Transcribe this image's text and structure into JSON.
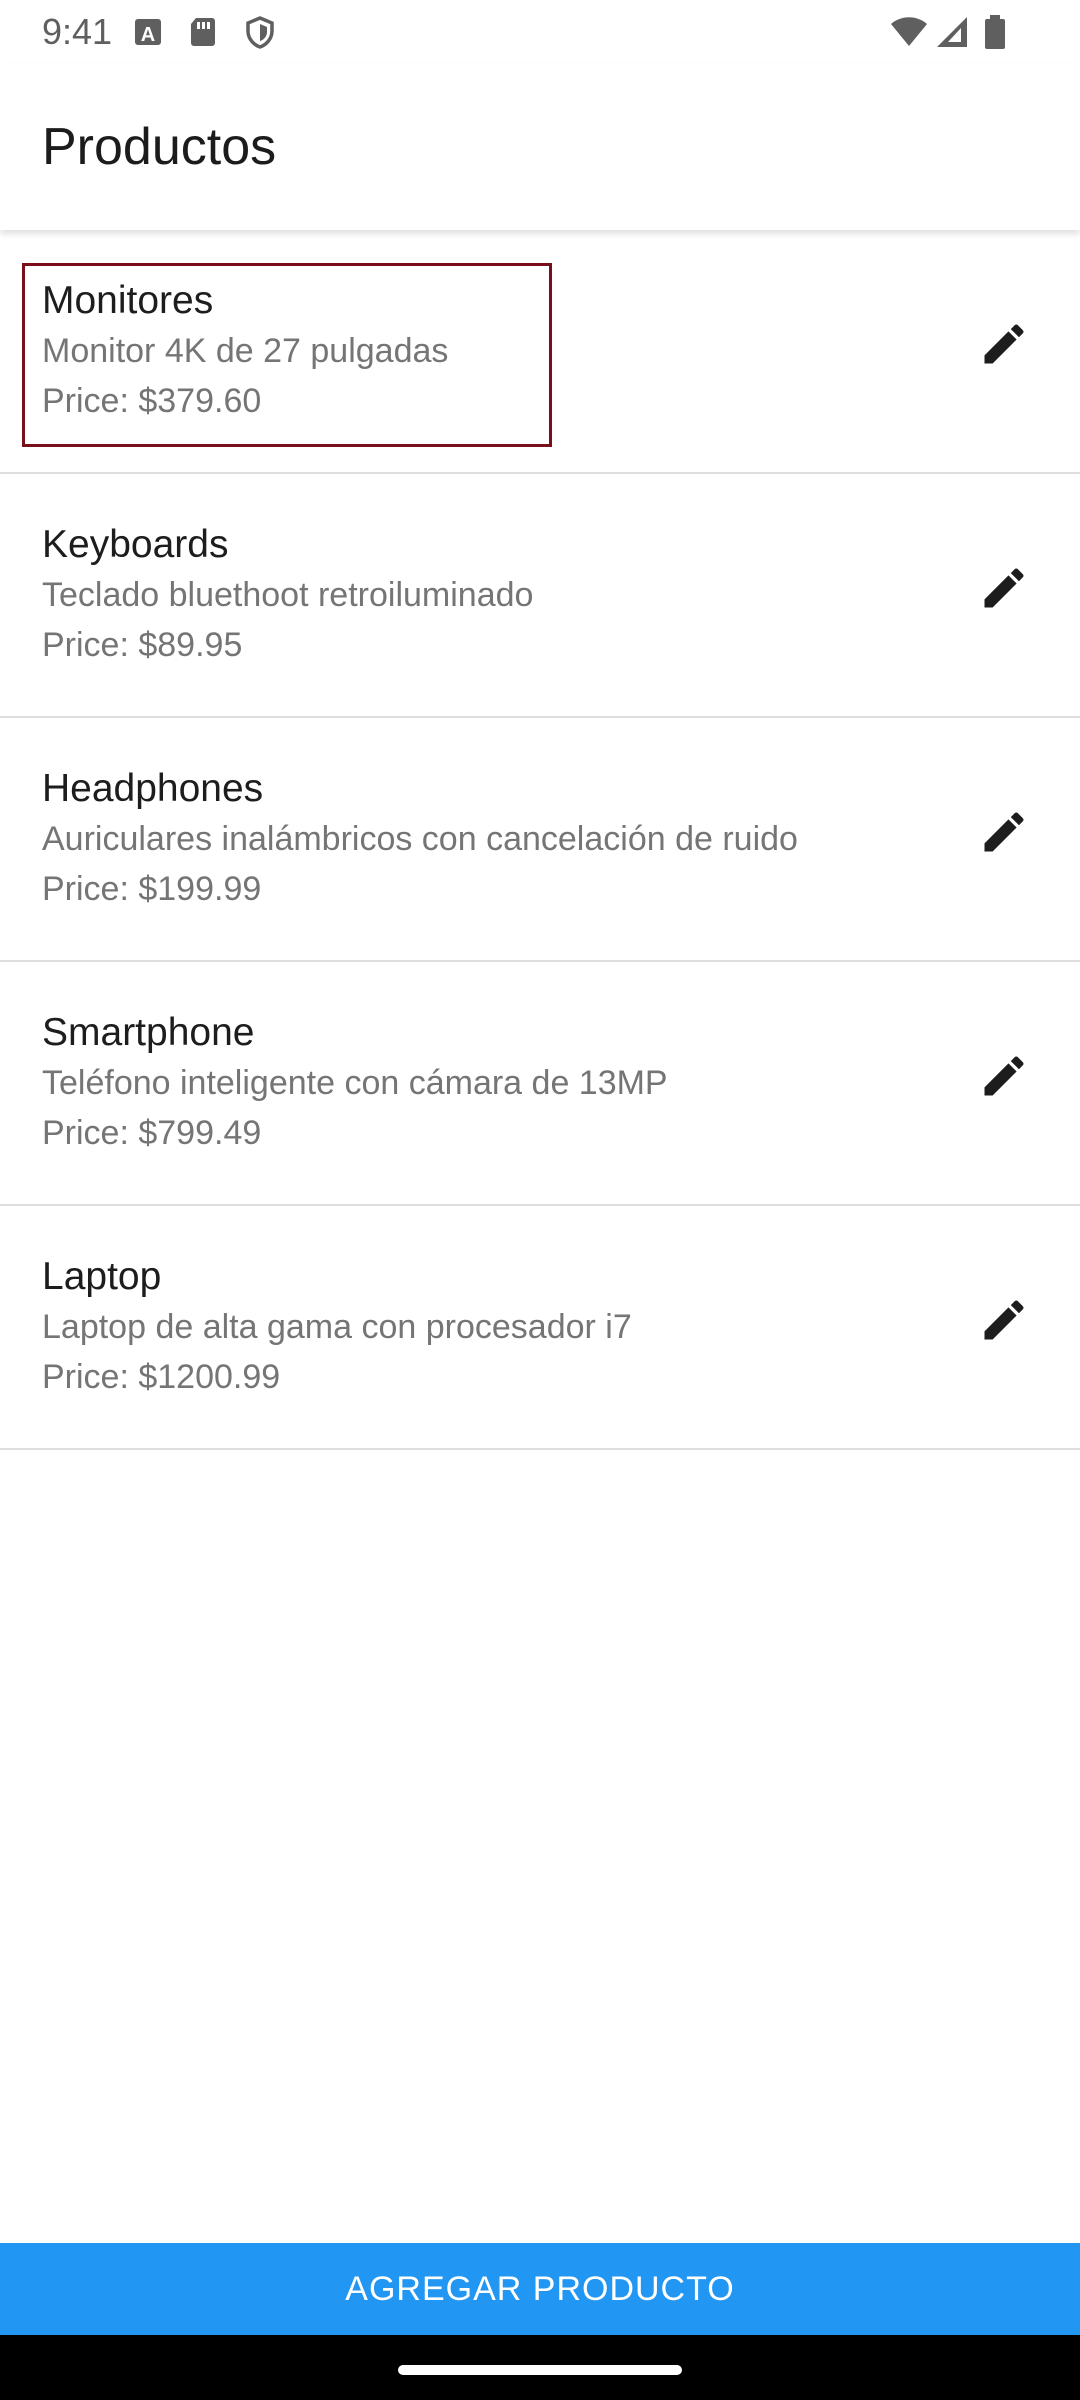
{
  "status_bar": {
    "time": "9:41",
    "icons": [
      "a-notification-icon",
      "sd-card-icon",
      "shield-icon",
      "wifi-icon",
      "signal-icon",
      "battery-icon"
    ]
  },
  "app_bar": {
    "title": "Productos"
  },
  "products": [
    {
      "name": "Monitores",
      "description": "Monitor 4K de 27 pulgadas",
      "price": "Price: $379.60",
      "edit_icon": "pencil-icon"
    },
    {
      "name": "Keyboards",
      "description": "Teclado bluethoot retroiluminado",
      "price": "Price: $89.95",
      "edit_icon": "pencil-icon"
    },
    {
      "name": "Headphones",
      "description": "Auriculares inalámbricos con cancelación de ruido",
      "price": "Price: $199.99",
      "edit_icon": "pencil-icon"
    },
    {
      "name": "Smartphone",
      "description": "Teléfono inteligente con cámara de 13MP",
      "price": "Price: $799.49",
      "edit_icon": "pencil-icon"
    },
    {
      "name": "Laptop",
      "description": "Laptop de alta gama con procesador i7",
      "price": "Price: $1200.99",
      "edit_icon": "pencil-icon"
    }
  ],
  "add_button": {
    "label": "AGREGAR PRODUCTO"
  },
  "colors": {
    "accent": "#2196f3",
    "highlight": "#7a0f1c",
    "divider": "#dedede",
    "secondary_text": "#757575"
  }
}
